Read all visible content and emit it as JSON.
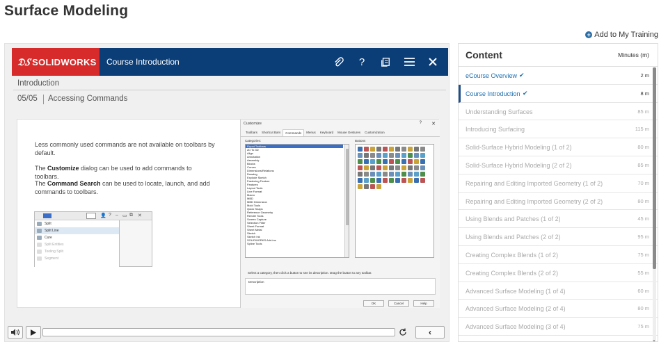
{
  "page": {
    "title": "Surface Modeling",
    "add_training": "Add to My Training"
  },
  "player": {
    "logo_text": "SOLIDWORKS",
    "course_title": "Course Introduction",
    "section": "Introduction",
    "slide_number": "05/05",
    "slide_name": "Accessing Commands",
    "slide_text": {
      "p1": "Less commonly used commands are not available on toolbars by default.",
      "p2_pre": "The ",
      "p2_bold": "Customize",
      "p2_post": " dialog can be used to add commands to toolbars.",
      "p3_pre": "The ",
      "p3_bold": "Command Search",
      "p3_post": " can be used to locate, launch, and add commands to toolbars."
    },
    "mini_menu": [
      "Split",
      "Split Line",
      "Cure",
      "Split Entities",
      "Tooling Split",
      "Segment"
    ],
    "dialog": {
      "title": "Customize",
      "tabs": [
        "Toolbars",
        "Shortcut Bars",
        "Commands",
        "Menus",
        "Keyboard",
        "Mouse Gestures",
        "Customization"
      ],
      "active_tab": "Commands",
      "categories_label": "Categories:",
      "buttons_label": "Buttons",
      "categories": [
        "Flyout Toolbars",
        "2D To 3D",
        "Align",
        "Annotation",
        "Assembly",
        "Blocks",
        "Curves",
        "Dimensions/Relations",
        "Drawing",
        "Explode Sketch",
        "Fastening Feature",
        "Features",
        "Layout Tools",
        "Line Format",
        "Macro",
        "MBD",
        "MBD Dimension",
        "Mold Tools",
        "Quick Snaps",
        "Reference Geometry",
        "Render Tools",
        "Screen Capture",
        "Selection Filter",
        "Sheet Format",
        "Sheet Metal",
        "Sketch",
        "Sketch Ink",
        "SOLIDWORKS Add-ins",
        "Spline Tools"
      ],
      "message": "Select a category, then click a button to see its description. Drag the button to any toolbar.",
      "description_label": "Description",
      "ok": "OK",
      "cancel": "Cancel",
      "help": "Help"
    },
    "controls": {
      "progress": 0
    }
  },
  "content": {
    "title": "Content",
    "minutes_header": "Minutes (m)",
    "items": [
      {
        "name": "eCourse Overview",
        "minutes": "2 m",
        "status": "done"
      },
      {
        "name": "Course Introduction",
        "minutes": "8 m",
        "status": "active"
      },
      {
        "name": "Understanding Surfaces",
        "minutes": "85 m",
        "status": "locked"
      },
      {
        "name": "Introducing Surfacing",
        "minutes": "115 m",
        "status": "locked"
      },
      {
        "name": "Solid-Surface Hybrid Modeling (1 of 2)",
        "minutes": "80 m",
        "status": "locked"
      },
      {
        "name": "Solid-Surface Hybrid Modeling (2 of 2)",
        "minutes": "85 m",
        "status": "locked"
      },
      {
        "name": "Repairing and Editing Imported Geometry (1 of 2)",
        "minutes": "70 m",
        "status": "locked"
      },
      {
        "name": "Repairing and Editing Imported Geometry (2 of 2)",
        "minutes": "80 m",
        "status": "locked"
      },
      {
        "name": "Using Blends and Patches (1 of 2)",
        "minutes": "45 m",
        "status": "locked"
      },
      {
        "name": "Using Blends and Patches (2 of 2)",
        "minutes": "95 m",
        "status": "locked"
      },
      {
        "name": "Creating Complex Blends (1 of 2)",
        "minutes": "75 m",
        "status": "locked"
      },
      {
        "name": "Creating Complex Blends (2 of 2)",
        "minutes": "55 m",
        "status": "locked"
      },
      {
        "name": "Advanced Surface Modeling (1 of 4)",
        "minutes": "60 m",
        "status": "locked"
      },
      {
        "name": "Advanced Surface Modeling (2 of 4)",
        "minutes": "80 m",
        "status": "locked"
      },
      {
        "name": "Advanced Surface Modeling (3 of 4)",
        "minutes": "75 m",
        "status": "locked"
      }
    ]
  },
  "colors": {
    "header_bar": "#0b3d77",
    "logo_red": "#d72a2a",
    "link_blue": "#1e6fb0"
  }
}
